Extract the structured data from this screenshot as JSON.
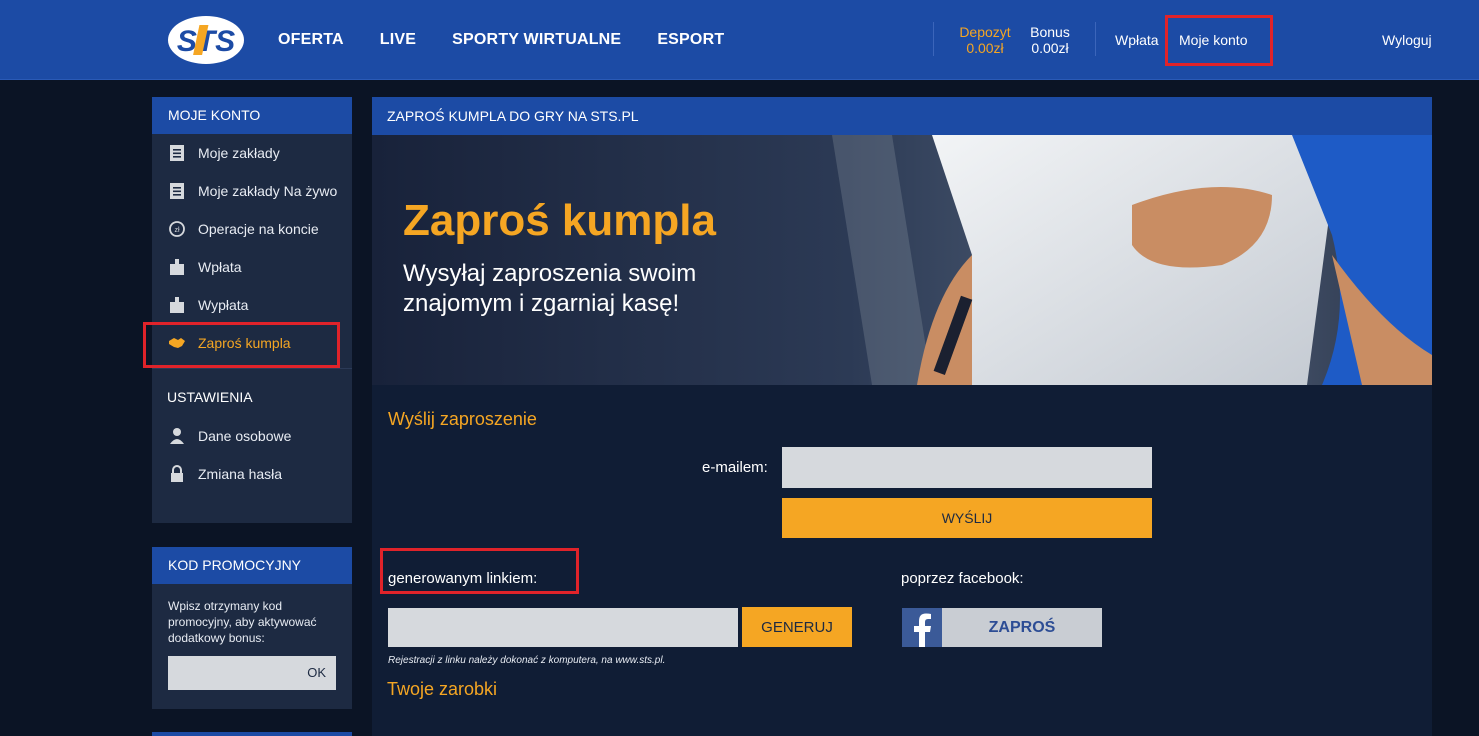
{
  "header": {
    "logo_text": "STS",
    "nav": [
      "OFERTA",
      "LIVE",
      "SPORTY WIRTUALNE",
      "ESPORT"
    ],
    "depozyt_label": "Depozyt",
    "depozyt_value": "0.00zł",
    "bonus_label": "Bonus",
    "bonus_value": "0.00zł",
    "wplata": "Wpłata",
    "moje_konto": "Moje konto",
    "wyloguj": "Wyloguj"
  },
  "sidebar": {
    "account_title": "MOJE KONTO",
    "items": [
      {
        "label": "Moje zakłady",
        "icon": "receipt-icon"
      },
      {
        "label": "Moje zakłady Na żywo",
        "icon": "receipt-icon"
      },
      {
        "label": "Operacje na koncie",
        "icon": "refresh-icon"
      },
      {
        "label": "Wpłata",
        "icon": "wallet-icon"
      },
      {
        "label": "Wypłata",
        "icon": "wallet-icon"
      },
      {
        "label": "Zaproś kumpla",
        "icon": "handshake-icon"
      }
    ],
    "settings_title": "USTAWIENIA",
    "settings_items": [
      {
        "label": "Dane osobowe",
        "icon": "user-icon"
      },
      {
        "label": "Zmiana hasła",
        "icon": "lock-icon"
      }
    ],
    "promo_title": "KOD PROMOCYJNY",
    "promo_text": "Wpisz otrzymany kod promocyjny, aby aktywować dodatkowy bonus:",
    "promo_ok": "OK"
  },
  "main": {
    "title": "ZAPROŚ KUMPLA DO GRY NA STS.PL",
    "banner_title": "Zaproś kumpla",
    "banner_sub": "Wysyłaj zaproszenia swoim znajomym i zgarniaj kasę!",
    "send_title": "Wyślij zaproszenie",
    "email_label": "e-mailem:",
    "email_value": "",
    "send_button": "WYŚLIJ",
    "link_label": "generowanym linkiem:",
    "link_value": "",
    "generate_button": "GENERUJ",
    "facebook_label": "poprzez facebook:",
    "facebook_button": "ZAPROŚ",
    "note": "Rejestracji z linku należy dokonać z komputera, na www.sts.pl.",
    "earnings_title": "Twoje zarobki"
  },
  "colors": {
    "brand_blue": "#1c4ba5",
    "accent_orange": "#f5a623",
    "highlight_red": "#e0232a"
  }
}
